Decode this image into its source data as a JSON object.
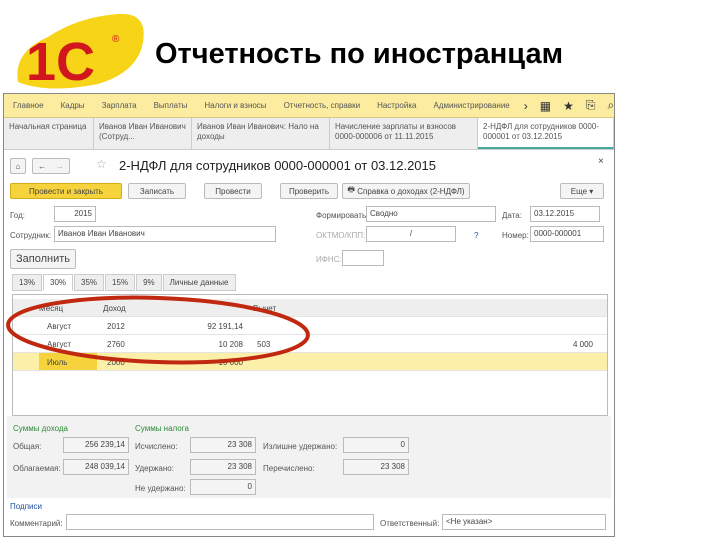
{
  "slide": {
    "title": "Отчетность по иностранцам",
    "logo_text": "1С"
  },
  "menu": [
    "Главное",
    "Кадры",
    "Зарплата",
    "Выплаты",
    "Налоги и взносы",
    "Отчетность, справки",
    "Настройка",
    "Администрирование"
  ],
  "open_tabs": [
    {
      "label": "Начальная страница"
    },
    {
      "label": "Иванов Иван Иванович (Сотруд..."
    },
    {
      "label": "Иванов Иван Иванович: Нало на доходы"
    },
    {
      "label": "Начисление зарплаты и взносов 0000-000006 от 11.11.2015"
    },
    {
      "label": "2-НДФЛ для сотрудников 0000-000001 от 03.12.2015"
    }
  ],
  "document": {
    "title": "2-НДФЛ для сотрудников 0000-000001 от 03.12.2015"
  },
  "toolbar": {
    "post_close": "Провести и закрыть",
    "save": "Записать",
    "post": "Провести",
    "check": "Проверить",
    "report": "Справка о доходах (2-НДФЛ)",
    "more": "Еще"
  },
  "form": {
    "year_label": "Год:",
    "year": "2015",
    "employee_label": "Сотрудник:",
    "employee": "Иванов Иван Иванович",
    "formed_label": "Формировать:",
    "formed": "Сводно",
    "date_label": "Дата:",
    "date": "03.12.2015",
    "oktmo_label": "ОКТМО/КПП:",
    "oktmo": "/",
    "number_label": "Номер:",
    "number": "0000-000001",
    "ifns_label": "ИФНС:",
    "ifns": "",
    "fill": "Заполнить"
  },
  "rate_tabs": [
    "13%",
    "30%",
    "35%",
    "15%",
    "9%",
    "Личные данные"
  ],
  "table": {
    "headers": [
      "Месяц",
      "Доход",
      "",
      "Вычет"
    ],
    "rows": [
      {
        "month": "Август",
        "code": "2012",
        "amount": "92 191,14",
        "ded_code": "",
        "ded": ""
      },
      {
        "month": "Август",
        "code": "2760",
        "amount": "10 208",
        "ded_code": "503",
        "ded": "4 000"
      },
      {
        "month": "Июль",
        "code": "2000",
        "amount": "10 000",
        "ded_code": "",
        "ded": ""
      }
    ]
  },
  "summary": {
    "income_title": "Суммы дохода",
    "tax_title": "Суммы налога",
    "total_label": "Общая:",
    "total": "256 239,14",
    "taxable_label": "Облагаемая:",
    "taxable": "248 039,14",
    "calc_label": "Исчислено:",
    "calc": "23 308",
    "held_label": "Удержано:",
    "held": "23 308",
    "notheld_label": "Не удержано:",
    "notheld": "0",
    "excess_label": "Излишне удержано:",
    "excess": "0",
    "transferred_label": "Перечислено:",
    "transferred": "23 308"
  },
  "footer": {
    "sign_link": "Подписи",
    "comment_label": "Комментарий:",
    "comment": "",
    "resp_label": "Ответственный:",
    "resp": "<Не указан>"
  },
  "colors": {
    "menu_bg": "#fbeca0",
    "accent": "#f6d33c",
    "ellipse": "#c0290f"
  }
}
